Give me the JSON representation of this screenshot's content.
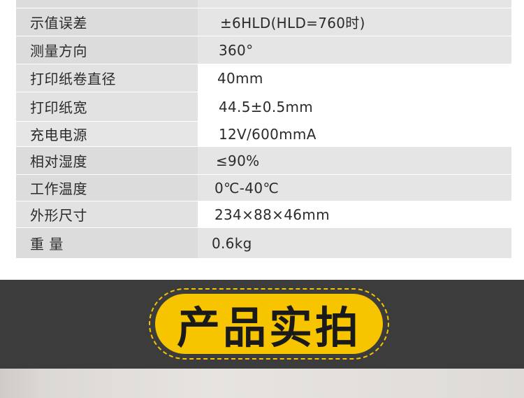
{
  "specs": [
    {
      "name": "示值误差",
      "value": "±6HLD(HLD=760时)"
    },
    {
      "name": "测量方向",
      "value": "360°"
    },
    {
      "name": "打印纸卷直径",
      "value": "40mm"
    },
    {
      "name": "打印纸宽",
      "value": "44.5±0.5mm"
    },
    {
      "name": "充电电源",
      "value": "12V/600mmA"
    },
    {
      "name": "相对湿度",
      "value": "≤90%"
    },
    {
      "name": "工作温度",
      "value": "0℃-40℃"
    },
    {
      "name": "外形尺寸",
      "value": "234×88×46mm"
    },
    {
      "name": "重 量",
      "value": "0.6kg"
    }
  ],
  "banner": {
    "title": "产品实拍",
    "colors": {
      "background": "#3c3c3c",
      "pill": "#f7c500",
      "text": "#1a1a1a"
    }
  }
}
